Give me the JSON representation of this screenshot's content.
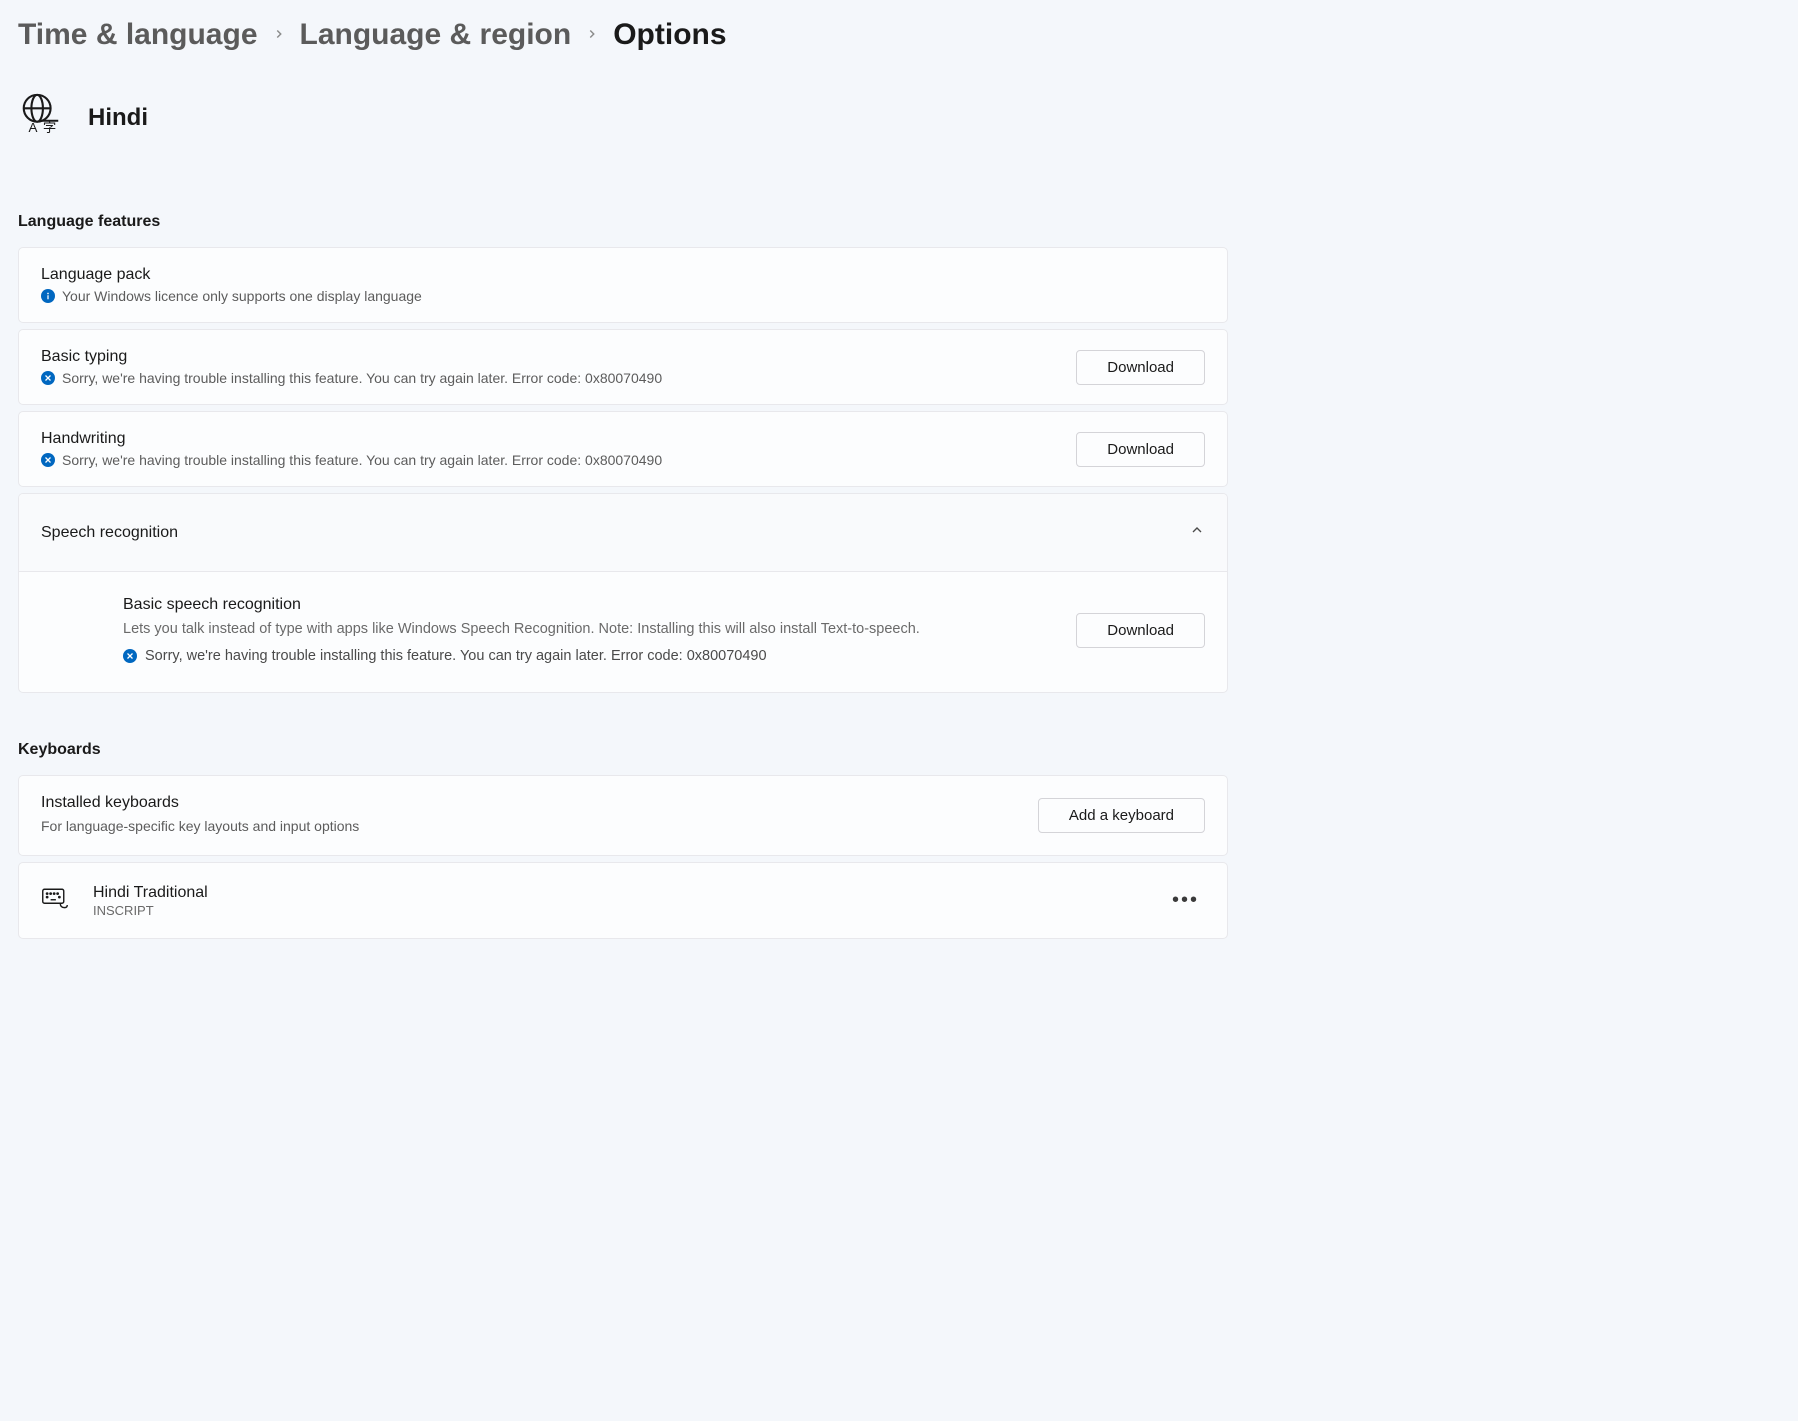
{
  "breadcrumb": {
    "level1": "Time & language",
    "level2": "Language & region",
    "current": "Options"
  },
  "language_name": "Hindi",
  "sections": {
    "features_heading": "Language features",
    "keyboards_heading": "Keyboards"
  },
  "features": {
    "language_pack": {
      "title": "Language pack",
      "status": "Your Windows licence only supports one display language"
    },
    "basic_typing": {
      "title": "Basic typing",
      "status": "Sorry, we're having trouble installing this feature. You can try again later. Error code: 0x80070490",
      "button": "Download"
    },
    "handwriting": {
      "title": "Handwriting",
      "status": "Sorry, we're having trouble installing this feature. You can try again later. Error code: 0x80070490",
      "button": "Download"
    },
    "speech": {
      "header": "Speech recognition",
      "sub_title": "Basic speech recognition",
      "desc": "Lets you talk instead of type with apps like Windows Speech Recognition. Note: Installing this will also install Text-to-speech.",
      "status": "Sorry, we're having trouble installing this feature. You can try again later. Error code: 0x80070490",
      "button": "Download"
    }
  },
  "keyboards": {
    "installed_title": "Installed keyboards",
    "installed_sub": "For language-specific key layouts and input options",
    "add_button": "Add a keyboard",
    "items": [
      {
        "name": "Hindi Traditional",
        "layout": "INSCRIPT"
      }
    ]
  }
}
